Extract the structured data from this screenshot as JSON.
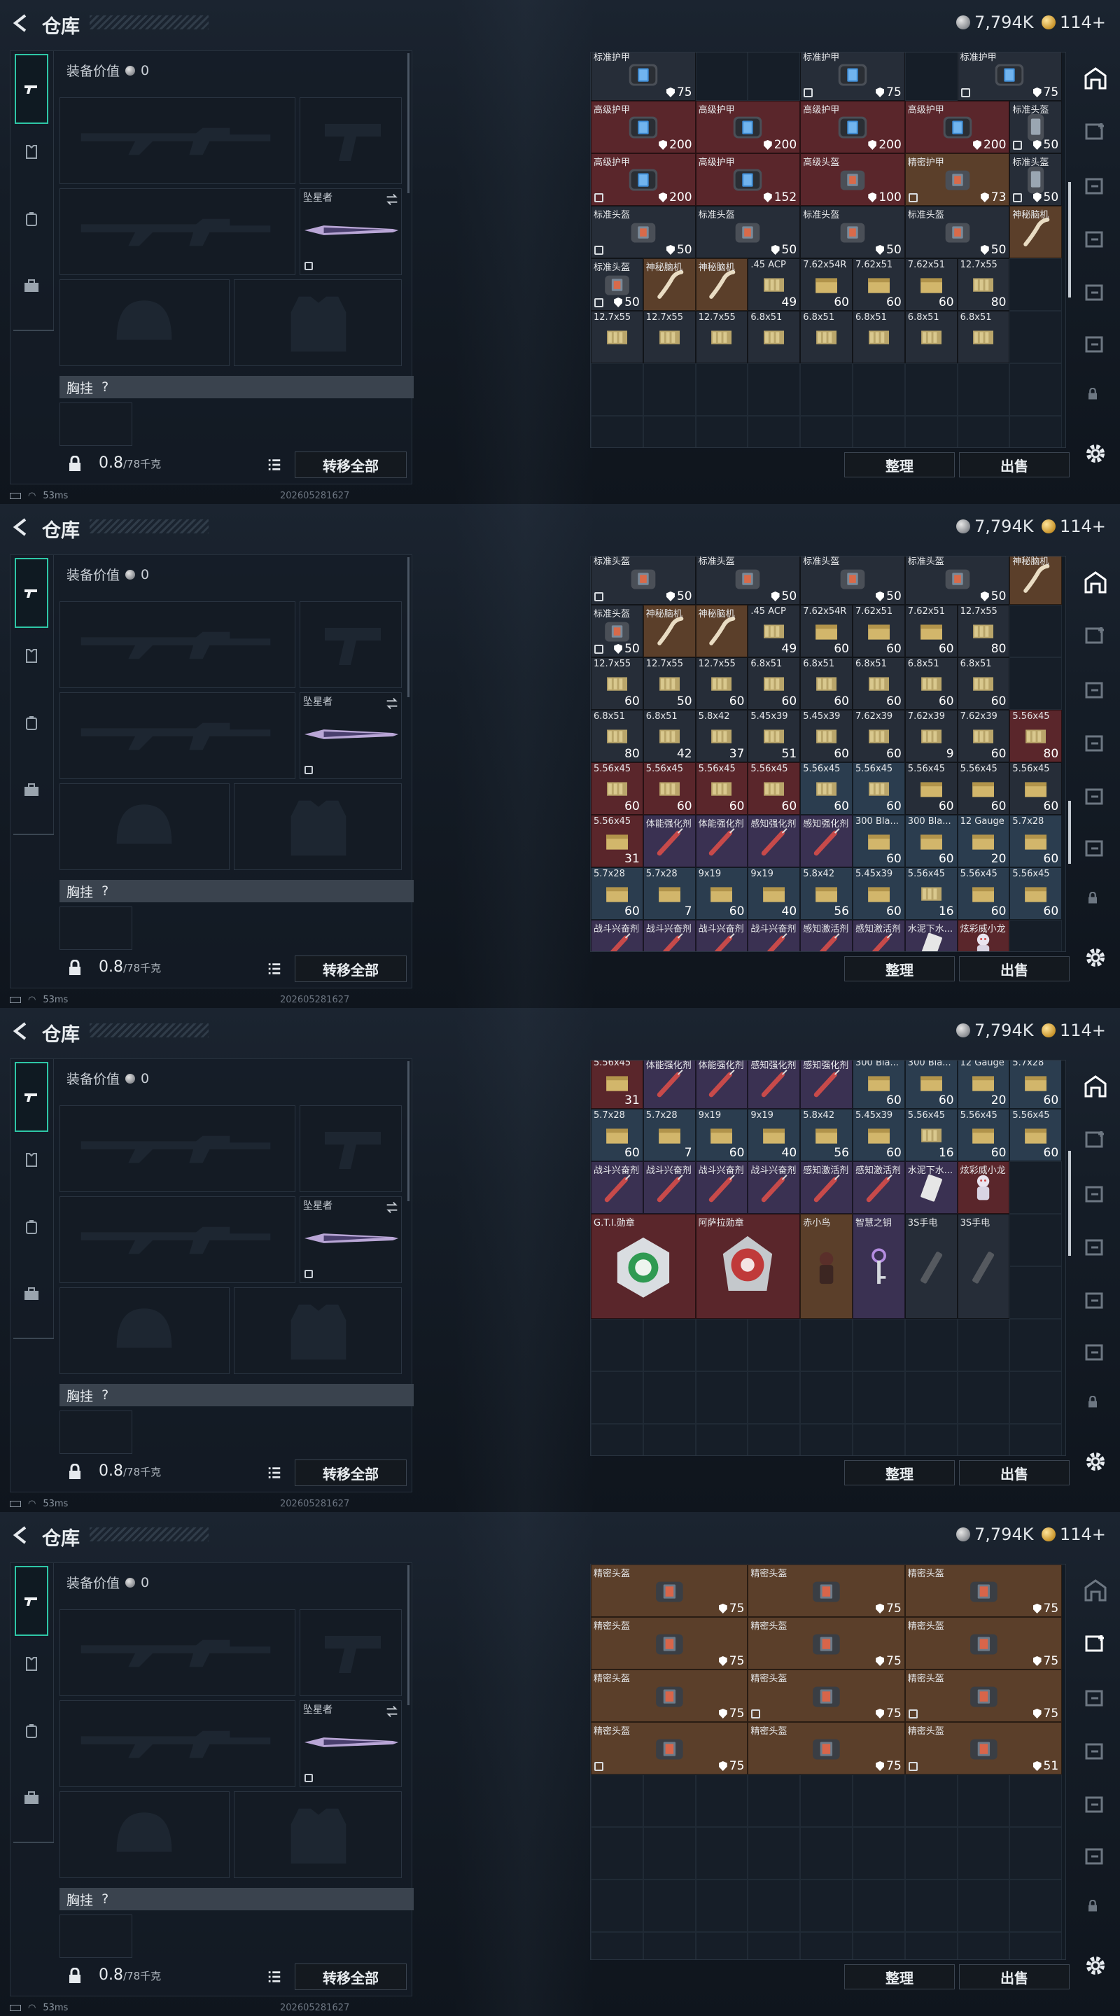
{
  "header": {
    "title": "仓库",
    "currency_silver": "7,794K",
    "currency_gold": "114+"
  },
  "loadout": {
    "equip_value_label": "装备价值",
    "equip_value": "0",
    "melee_name": "坠星者",
    "chest_rig_label": "胸挂",
    "chest_rig_help": "?",
    "weight": "0.8",
    "weight_max": "/78千克",
    "transfer_all": "转移全部"
  },
  "actions": {
    "sort": "整理",
    "sell": "出售"
  },
  "status": {
    "ping": "53ms",
    "build": "202605281627"
  },
  "colors": {
    "accent": "#2ec6a6",
    "rare_red": "#5a262b",
    "epic_purple": "#3a3152",
    "gold_brown": "#5b3f2a",
    "blue_grey": "#2b3d4f"
  },
  "panels": [
    {
      "rows": [
        [
          {
            "n": "标准护甲",
            "v": "75",
            "c": "n",
            "i": "armor",
            "sh": true
          },
          {
            "n": "标准护甲",
            "v": "75",
            "c": "n",
            "i": "armor",
            "sh": true,
            "lk": true
          },
          {
            "n": "标准护甲",
            "v": "75",
            "c": "n",
            "i": "armor",
            "sh": true,
            "lk": true
          }
        ],
        [
          {
            "n": "高级护甲",
            "v": "200",
            "c": "r",
            "i": "armor",
            "sh": true
          },
          {
            "n": "高级护甲",
            "v": "200",
            "c": "r",
            "i": "armor",
            "sh": true
          },
          {
            "n": "高级护甲",
            "v": "200",
            "c": "r",
            "i": "armor",
            "sh": true
          },
          {
            "n": "高级护甲",
            "v": "200",
            "c": "r",
            "i": "armor",
            "sh": true
          },
          {
            "n": "标准头盔",
            "v": "50",
            "c": "n",
            "i": "helm",
            "sh": true,
            "lk": true
          }
        ],
        [
          {
            "n": "高级护甲",
            "v": "200",
            "c": "r",
            "i": "armor",
            "sh": true,
            "lk": true
          },
          {
            "n": "高级护甲",
            "v": "152",
            "c": "r",
            "i": "armor",
            "sh": true
          },
          {
            "n": "高级头盔",
            "v": "100",
            "c": "r",
            "i": "armor2",
            "sh": true
          },
          {
            "n": "精密护甲",
            "v": "73",
            "c": "o",
            "i": "armor2",
            "sh": true,
            "lk": true
          },
          {
            "n": "标准头盔",
            "v": "50",
            "c": "n",
            "i": "helm",
            "sh": true,
            "lk": true
          }
        ],
        [
          {
            "n": "标准头盔",
            "v": "50",
            "c": "n",
            "i": "armor2",
            "sh": true,
            "lk": true
          },
          {
            "n": "标准头盔",
            "v": "50",
            "c": "n",
            "i": "armor2",
            "sh": true
          },
          {
            "n": "标准头盔",
            "v": "50",
            "c": "n",
            "i": "armor2",
            "sh": true
          },
          {
            "n": "标准头盔",
            "v": "50",
            "c": "n",
            "i": "armor2",
            "sh": true
          },
          {
            "n": "神秘脑机",
            "v": "",
            "c": "o",
            "i": "bone"
          }
        ],
        [
          {
            "n": "标准头盔",
            "v": "50",
            "c": "n",
            "i": "armor2",
            "sh": true,
            "lk": true
          },
          {
            "n": "神秘脑机",
            "v": "",
            "c": "o",
            "i": "bone"
          },
          {
            "n": "神秘脑机",
            "v": "",
            "c": "o",
            "i": "bone"
          },
          {
            "n": ".45 ACP",
            "v": "49",
            "c": "n",
            "i": "ammo"
          },
          {
            "n": "7.62x54R",
            "v": "60",
            "c": "n",
            "i": "box"
          },
          {
            "n": "7.62x51",
            "v": "60",
            "c": "n",
            "i": "box"
          },
          {
            "n": "7.62x51",
            "v": "60",
            "c": "n",
            "i": "box"
          },
          {
            "n": "12.7x55",
            "v": "80",
            "c": "n",
            "i": "ammo"
          }
        ],
        [
          {
            "n": "12.7x55",
            "v": "",
            "c": "n",
            "i": "ammo"
          },
          {
            "n": "12.7x55",
            "v": "",
            "c": "n",
            "i": "ammo"
          },
          {
            "n": "12.7x55",
            "v": "",
            "c": "n",
            "i": "ammo"
          },
          {
            "n": "6.8x51",
            "v": "",
            "c": "n",
            "i": "ammo"
          },
          {
            "n": "6.8x51",
            "v": "",
            "c": "n",
            "i": "ammo"
          },
          {
            "n": "6.8x51",
            "v": "",
            "c": "n",
            "i": "ammo"
          },
          {
            "n": "6.8x51",
            "v": "",
            "c": "n",
            "i": "ammo"
          },
          {
            "n": "6.8x51",
            "v": "",
            "c": "n",
            "i": "ammo"
          }
        ]
      ]
    },
    {
      "rows": [
        [
          {
            "n": "标准头盔",
            "v": "50",
            "c": "n",
            "i": "armor2",
            "sh": true,
            "lk": true
          },
          {
            "n": "标准头盔",
            "v": "50",
            "c": "n",
            "i": "armor2",
            "sh": true
          },
          {
            "n": "标准头盔",
            "v": "50",
            "c": "n",
            "i": "armor2",
            "sh": true
          },
          {
            "n": "标准头盔",
            "v": "50",
            "c": "n",
            "i": "armor2",
            "sh": true
          },
          {
            "n": "神秘脑机",
            "v": "",
            "c": "o",
            "i": "bone"
          }
        ],
        [
          {
            "n": "标准头盔",
            "v": "50",
            "c": "n",
            "i": "armor2",
            "sh": true,
            "lk": true
          },
          {
            "n": "神秘脑机",
            "v": "",
            "c": "o",
            "i": "bone"
          },
          {
            "n": "神秘脑机",
            "v": "",
            "c": "o",
            "i": "bone"
          },
          {
            "n": ".45 ACP",
            "v": "49",
            "c": "n",
            "i": "ammo"
          },
          {
            "n": "7.62x54R",
            "v": "60",
            "c": "n",
            "i": "box"
          },
          {
            "n": "7.62x51",
            "v": "60",
            "c": "n",
            "i": "box"
          },
          {
            "n": "7.62x51",
            "v": "60",
            "c": "n",
            "i": "box"
          },
          {
            "n": "12.7x55",
            "v": "80",
            "c": "n",
            "i": "ammo"
          }
        ],
        [
          {
            "n": "12.7x55",
            "v": "60",
            "c": "n",
            "i": "ammo"
          },
          {
            "n": "12.7x55",
            "v": "50",
            "c": "n",
            "i": "ammo"
          },
          {
            "n": "12.7x55",
            "v": "60",
            "c": "n",
            "i": "ammo"
          },
          {
            "n": "6.8x51",
            "v": "60",
            "c": "n",
            "i": "ammo"
          },
          {
            "n": "6.8x51",
            "v": "60",
            "c": "n",
            "i": "ammo"
          },
          {
            "n": "6.8x51",
            "v": "60",
            "c": "n",
            "i": "ammo"
          },
          {
            "n": "6.8x51",
            "v": "60",
            "c": "n",
            "i": "ammo"
          },
          {
            "n": "6.8x51",
            "v": "60",
            "c": "n",
            "i": "ammo"
          }
        ],
        [
          {
            "n": "6.8x51",
            "v": "80",
            "c": "n",
            "i": "ammo"
          },
          {
            "n": "6.8x51",
            "v": "42",
            "c": "n",
            "i": "ammo"
          },
          {
            "n": "5.8x42",
            "v": "37",
            "c": "n",
            "i": "ammo"
          },
          {
            "n": "5.45x39",
            "v": "51",
            "c": "n",
            "i": "ammo"
          },
          {
            "n": "5.45x39",
            "v": "60",
            "c": "n",
            "i": "ammo"
          },
          {
            "n": "7.62x39",
            "v": "60",
            "c": "n",
            "i": "ammo"
          },
          {
            "n": "7.62x39",
            "v": "9",
            "c": "n",
            "i": "ammo"
          },
          {
            "n": "7.62x39",
            "v": "60",
            "c": "n",
            "i": "ammo"
          },
          {
            "n": "5.56x45",
            "v": "80",
            "c": "r",
            "i": "ammo"
          }
        ],
        [
          {
            "n": "5.56x45",
            "v": "60",
            "c": "r",
            "i": "ammo"
          },
          {
            "n": "5.56x45",
            "v": "60",
            "c": "r",
            "i": "ammo"
          },
          {
            "n": "5.56x45",
            "v": "60",
            "c": "r",
            "i": "ammo"
          },
          {
            "n": "5.56x45",
            "v": "60",
            "c": "r",
            "i": "ammo"
          },
          {
            "n": "5.56x45",
            "v": "60",
            "c": "g",
            "i": "ammo"
          },
          {
            "n": "5.56x45",
            "v": "60",
            "c": "g",
            "i": "ammo"
          },
          {
            "n": "5.56x45",
            "v": "60",
            "c": "n",
            "i": "box"
          },
          {
            "n": "5.56x45",
            "v": "60",
            "c": "n",
            "i": "box"
          },
          {
            "n": "5.56x45",
            "v": "60",
            "c": "n",
            "i": "box"
          }
        ],
        [
          {
            "n": "5.56x45",
            "v": "31",
            "c": "r",
            "i": "box"
          },
          {
            "n": "体能强化剂",
            "v": "",
            "c": "p",
            "i": "syr"
          },
          {
            "n": "体能强化剂",
            "v": "",
            "c": "p",
            "i": "syr"
          },
          {
            "n": "感知强化剂",
            "v": "",
            "c": "p",
            "i": "syr"
          },
          {
            "n": "感知强化剂",
            "v": "",
            "c": "p",
            "i": "syr"
          },
          {
            "n": "300 Bla...",
            "v": "60",
            "c": "g",
            "i": "box"
          },
          {
            "n": "300 Bla...",
            "v": "60",
            "c": "g",
            "i": "box"
          },
          {
            "n": "12 Gauge",
            "v": "20",
            "c": "g",
            "i": "box"
          },
          {
            "n": "5.7x28",
            "v": "60",
            "c": "g",
            "i": "box"
          }
        ],
        [
          {
            "n": "5.7x28",
            "v": "60",
            "c": "g",
            "i": "box"
          },
          {
            "n": "5.7x28",
            "v": "7",
            "c": "g",
            "i": "box"
          },
          {
            "n": "9x19",
            "v": "60",
            "c": "g",
            "i": "box"
          },
          {
            "n": "9x19",
            "v": "40",
            "c": "g",
            "i": "box"
          },
          {
            "n": "5.8x42",
            "v": "56",
            "c": "g",
            "i": "box"
          },
          {
            "n": "5.45x39",
            "v": "60",
            "c": "g",
            "i": "box"
          },
          {
            "n": "5.56x45",
            "v": "16",
            "c": "g",
            "i": "ammo"
          },
          {
            "n": "5.56x45",
            "v": "60",
            "c": "g",
            "i": "box"
          },
          {
            "n": "5.56x45",
            "v": "60",
            "c": "g",
            "i": "box"
          }
        ],
        [
          {
            "n": "战斗兴奋剂",
            "v": "",
            "c": "p",
            "i": "syr"
          },
          {
            "n": "战斗兴奋剂",
            "v": "",
            "c": "p",
            "i": "syr"
          },
          {
            "n": "战斗兴奋剂",
            "v": "",
            "c": "p",
            "i": "syr"
          },
          {
            "n": "战斗兴奋剂",
            "v": "",
            "c": "p",
            "i": "syr"
          },
          {
            "n": "感知激活剂",
            "v": "",
            "c": "p",
            "i": "syr"
          },
          {
            "n": "感知激活剂",
            "v": "",
            "c": "p",
            "i": "syr"
          },
          {
            "n": "水泥下水...",
            "v": "",
            "c": "p",
            "i": "can"
          },
          {
            "n": "炫彩威小龙",
            "v": "",
            "c": "r",
            "i": "toy"
          }
        ]
      ]
    },
    {
      "rows": [
        [
          {
            "n": "5.56x45",
            "v": "31",
            "c": "r",
            "i": "box"
          },
          {
            "n": "体能强化剂",
            "v": "",
            "c": "p",
            "i": "syr"
          },
          {
            "n": "体能强化剂",
            "v": "",
            "c": "p",
            "i": "syr"
          },
          {
            "n": "感知强化剂",
            "v": "",
            "c": "p",
            "i": "syr"
          },
          {
            "n": "感知强化剂",
            "v": "",
            "c": "p",
            "i": "syr"
          },
          {
            "n": "300 Bla...",
            "v": "60",
            "c": "g",
            "i": "box"
          },
          {
            "n": "300 Bla...",
            "v": "60",
            "c": "g",
            "i": "box"
          },
          {
            "n": "12 Gauge",
            "v": "20",
            "c": "g",
            "i": "box"
          },
          {
            "n": "5.7x28",
            "v": "60",
            "c": "g",
            "i": "box"
          }
        ],
        [
          {
            "n": "5.7x28",
            "v": "60",
            "c": "g",
            "i": "box"
          },
          {
            "n": "5.7x28",
            "v": "7",
            "c": "g",
            "i": "box"
          },
          {
            "n": "9x19",
            "v": "60",
            "c": "g",
            "i": "box"
          },
          {
            "n": "9x19",
            "v": "40",
            "c": "g",
            "i": "box"
          },
          {
            "n": "5.8x42",
            "v": "56",
            "c": "g",
            "i": "box"
          },
          {
            "n": "5.45x39",
            "v": "60",
            "c": "g",
            "i": "box"
          },
          {
            "n": "5.56x45",
            "v": "16",
            "c": "g",
            "i": "ammo"
          },
          {
            "n": "5.56x45",
            "v": "60",
            "c": "g",
            "i": "box"
          },
          {
            "n": "5.56x45",
            "v": "60",
            "c": "g",
            "i": "box"
          }
        ],
        [
          {
            "n": "战斗兴奋剂",
            "v": "",
            "c": "p",
            "i": "syr"
          },
          {
            "n": "战斗兴奋剂",
            "v": "",
            "c": "p",
            "i": "syr"
          },
          {
            "n": "战斗兴奋剂",
            "v": "",
            "c": "p",
            "i": "syr"
          },
          {
            "n": "战斗兴奋剂",
            "v": "",
            "c": "p",
            "i": "syr"
          },
          {
            "n": "感知激活剂",
            "v": "",
            "c": "p",
            "i": "syr"
          },
          {
            "n": "感知激活剂",
            "v": "",
            "c": "p",
            "i": "syr"
          },
          {
            "n": "水泥下水...",
            "v": "",
            "c": "p",
            "i": "can"
          },
          {
            "n": "炫彩威小龙",
            "v": "",
            "c": "r",
            "i": "toy"
          }
        ],
        [
          {
            "n": "G.T.I.勋章",
            "v": "",
            "c": "r",
            "i": "medal"
          },
          {
            "n": "阿萨拉勋章",
            "v": "",
            "c": "r",
            "i": "medal2"
          },
          {
            "n": "赤小鸟",
            "v": "",
            "c": "o",
            "i": "fig"
          },
          {
            "n": "智慧之钥",
            "v": "",
            "c": "p",
            "i": "key"
          },
          {
            "n": "3S手电",
            "v": "",
            "c": "n",
            "i": "torch"
          },
          {
            "n": "3S手电",
            "v": "",
            "c": "n",
            "i": "torch"
          }
        ]
      ]
    },
    {
      "rows": [
        [
          {
            "n": "精密头盔",
            "v": "75",
            "c": "o",
            "i": "helm2",
            "sh": true
          },
          {
            "n": "精密头盔",
            "v": "75",
            "c": "o",
            "i": "helm2",
            "sh": true
          },
          {
            "n": "精密头盔",
            "v": "75",
            "c": "o",
            "i": "helm2",
            "sh": true
          }
        ],
        [
          {
            "n": "精密头盔",
            "v": "75",
            "c": "o",
            "i": "helm2",
            "sh": true
          },
          {
            "n": "精密头盔",
            "v": "75",
            "c": "o",
            "i": "helm2",
            "sh": true
          },
          {
            "n": "精密头盔",
            "v": "75",
            "c": "o",
            "i": "helm2",
            "sh": true
          }
        ],
        [
          {
            "n": "精密头盔",
            "v": "75",
            "c": "o",
            "i": "helm2",
            "sh": true
          },
          {
            "n": "精密头盔",
            "v": "75",
            "c": "o",
            "i": "helm2",
            "sh": true,
            "lk": true
          },
          {
            "n": "精密头盔",
            "v": "75",
            "c": "o",
            "i": "helm2",
            "sh": true,
            "lk": true
          }
        ],
        [
          {
            "n": "精密头盔",
            "v": "75",
            "c": "o",
            "i": "helm2",
            "sh": true,
            "lk": true
          },
          {
            "n": "精密头盔",
            "v": "75",
            "c": "o",
            "i": "helm2",
            "sh": true
          },
          {
            "n": "精密头盔",
            "v": "51",
            "c": "o",
            "i": "helm2",
            "sh": true,
            "lk": true
          }
        ]
      ]
    }
  ]
}
